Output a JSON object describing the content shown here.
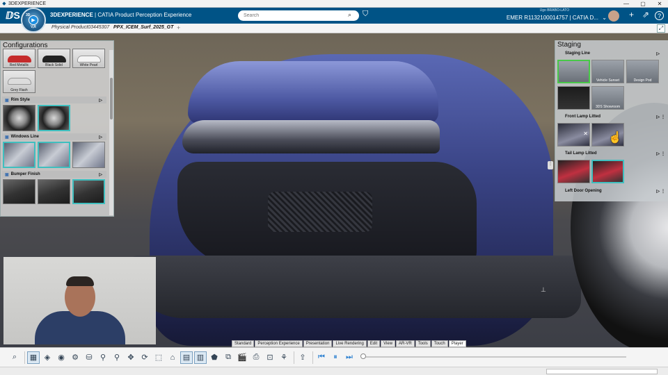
{
  "window": {
    "title": "3DEXPERIENCE",
    "minimize": "—",
    "restore": "▢",
    "close": "✕"
  },
  "appbar": {
    "brand_bold": "3DEXPERIENCE",
    "brand_rest": " | CATIA  Product Perception Experience",
    "search_placeholder": "Search",
    "user": "Ugo BRABO-LATO",
    "context": "EMER R1132100014757 | CATIA D...",
    "compass_top": "3D",
    "compass_bottom": "V,R"
  },
  "tabs": [
    {
      "label": "Physical Product03445307"
    },
    {
      "label": "PPX_ICEM_Surf_2025_GT"
    },
    {
      "label": "+"
    }
  ],
  "configurations": {
    "title": "Configurations",
    "paints": [
      {
        "label": "Red Metallic",
        "color": "#c52b2b"
      },
      {
        "label": "Black Solid",
        "color": "#222222"
      },
      {
        "label": "White Pearl",
        "color": "#f4f4f4"
      },
      {
        "label": "Grey Flash",
        "color": "#dcdcdc"
      }
    ],
    "sections": [
      {
        "label": "Rim Style",
        "arrow": "▷"
      },
      {
        "label": "Windows Line",
        "arrow": "▷"
      },
      {
        "label": "Bumper Finish",
        "arrow": "▷"
      }
    ]
  },
  "staging": {
    "title": "Staging",
    "lines": [
      {
        "label": "Staging Line",
        "arrow": "▷"
      },
      {
        "label": "Front Lamp Litted",
        "arrow": "▷",
        "more": "⋮"
      },
      {
        "label": "Tail Lamp Litted",
        "arrow": "▷",
        "more": "⋮"
      },
      {
        "label": "Left Door Opening",
        "arrow": "▷",
        "more": "⋮"
      }
    ],
    "thumbs": [
      {
        "label": ""
      },
      {
        "label": "Vehicle Sunset"
      },
      {
        "label": "Design Pod"
      },
      {
        "label": ""
      },
      {
        "label": "3DS Showroom"
      }
    ]
  },
  "mode_tabs": [
    "Standard",
    "Perception Experience",
    "Presentation",
    "Live Rendering",
    "Edit",
    "View",
    "AR-VR",
    "Tools",
    "Touch",
    "Player"
  ],
  "mode_active": "Player",
  "icons": {
    "ds_logo": "ⅅS",
    "search": "⌕",
    "tag": "⛉",
    "share": "⇗",
    "help": "?",
    "add": "+",
    "fullscreen": "⤢"
  },
  "colors": {
    "brand_blue": "#005386",
    "selection_green": "#48c848",
    "selection_teal": "#3fbfbf"
  }
}
